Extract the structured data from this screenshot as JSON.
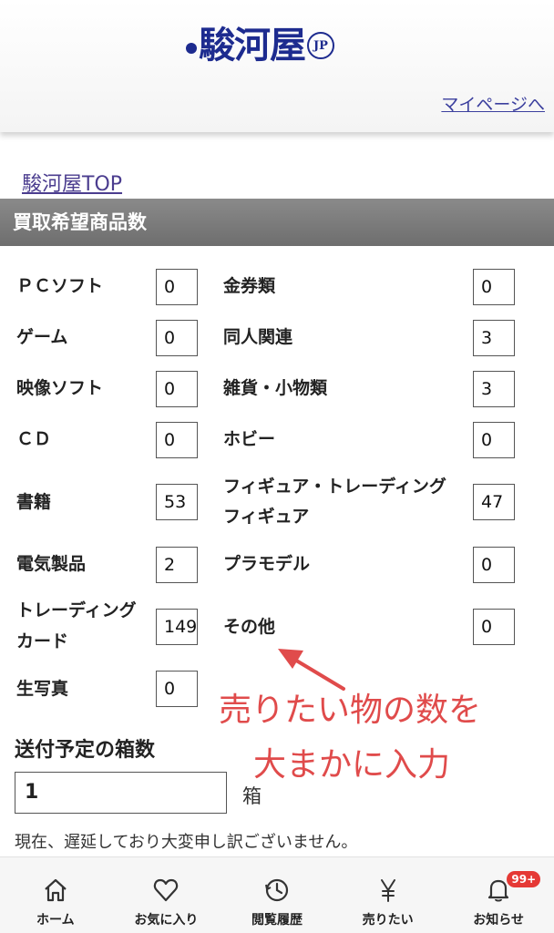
{
  "header": {
    "logo_text": "駿河屋",
    "logo_suffix": "JP",
    "mypage_link": "マイページへ"
  },
  "breadcrumb": {
    "top_link": "駿河屋TOP"
  },
  "section": {
    "title": "買取希望商品数"
  },
  "left_items": [
    {
      "label": "ＰＣソフト",
      "value": "0"
    },
    {
      "label": "ゲーム",
      "value": "0"
    },
    {
      "label": "映像ソフト",
      "value": "0"
    },
    {
      "label": "ＣＤ",
      "value": "0"
    },
    {
      "label": "書籍",
      "value": "53"
    },
    {
      "label": "電気製品",
      "value": "2"
    },
    {
      "label": "トレーディング",
      "label2": "カード",
      "value": "149"
    },
    {
      "label": "生写真",
      "value": "0"
    }
  ],
  "right_items": [
    {
      "label": "金券類",
      "value": "0"
    },
    {
      "label": "同人関連",
      "value": "3"
    },
    {
      "label": "雑貨・小物類",
      "value": "3"
    },
    {
      "label": "ホビー",
      "value": "0"
    },
    {
      "label": "フィギュア・トレーディング",
      "label2": "フィギュア",
      "value": "47"
    },
    {
      "label": "プラモデル",
      "value": "0"
    },
    {
      "label": "その他",
      "value": "0"
    }
  ],
  "boxes": {
    "title": "送付予定の箱数",
    "value": "1",
    "unit": "箱"
  },
  "notice": "現在、遅延しており大変申し訳ございません。",
  "annotation": {
    "line1": "売りたい物の数を",
    "line2": "大まかに入力",
    "color": "#e04b4b"
  },
  "tabbar": {
    "items": [
      {
        "label": "ホーム",
        "icon": "home-icon"
      },
      {
        "label": "お気に入り",
        "icon": "heart-icon"
      },
      {
        "label": "閲覧履歴",
        "icon": "clock-icon"
      },
      {
        "label": "売りたい",
        "icon": "yen-icon"
      },
      {
        "label": "お知らせ",
        "icon": "bell-icon",
        "badge": "99+"
      }
    ]
  }
}
